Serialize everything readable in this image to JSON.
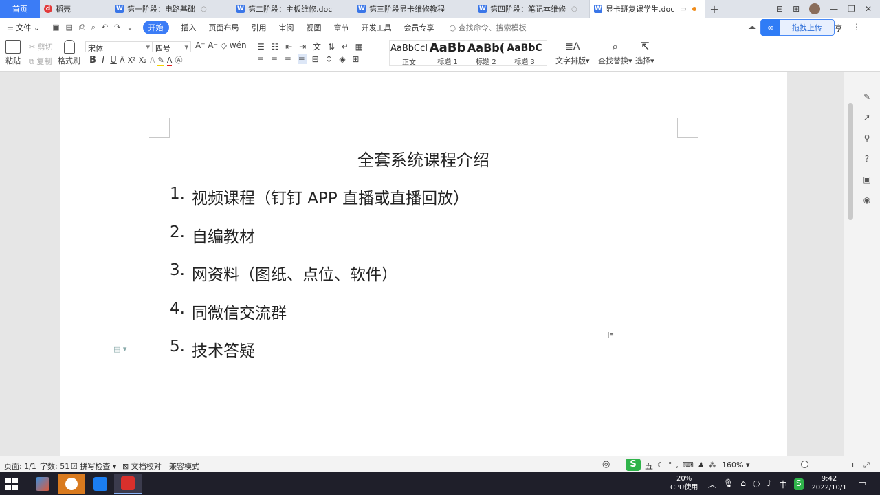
{
  "tabs": {
    "home": "首页",
    "items": [
      {
        "label": "稻壳",
        "icon": "daoke-icon",
        "type": "d"
      },
      {
        "label": "第一阶段：电路基础",
        "icon": "word-doc-icon",
        "type": "w"
      },
      {
        "label": "第二阶段：主板维修.doc",
        "icon": "word-doc-icon",
        "type": "w"
      },
      {
        "label": "第三阶段显卡维修教程",
        "icon": "word-doc-icon",
        "type": "w"
      },
      {
        "label": "第四阶段：笔记本维修",
        "icon": "word-doc-icon",
        "type": "w"
      }
    ],
    "active": "显卡班复课学生.doc"
  },
  "menu": {
    "file": "文件",
    "items": [
      "开始",
      "插入",
      "页面布局",
      "引用",
      "审阅",
      "视图",
      "章节",
      "开发工具",
      "会员专享"
    ],
    "active_index": 0,
    "search_placeholder": "查找命令、搜索模板",
    "upload_label": "拖拽上传",
    "share_label": "享"
  },
  "ribbon": {
    "paste": "粘贴",
    "cut": "剪切",
    "copy": "复制",
    "format_painter": "格式刷",
    "font_name": "宋体",
    "font_size": "四号",
    "bold": "B",
    "italic": "I",
    "underline": "U",
    "styles": [
      {
        "preview": "AaBbCcI",
        "name": "正文"
      },
      {
        "preview": "AaBb",
        "name": "标题 1"
      },
      {
        "preview": "AaBb(",
        "name": "标题 2"
      },
      {
        "preview": "AaBbC",
        "name": "标题 3"
      }
    ],
    "text_layout": "文字排版",
    "find_replace": "查找替换",
    "select": "选择"
  },
  "document": {
    "title": "全套系统课程介绍",
    "items": [
      {
        "num": "1.",
        "text": "视频课程（钉钉 APP  直播或直播回放）"
      },
      {
        "num": "2.",
        "text": "自编教材"
      },
      {
        "num": "3.",
        "text": "网资料（图纸、点位、软件）"
      },
      {
        "num": "4.",
        "text": "同微信交流群"
      },
      {
        "num": "5.",
        "text": "技术答疑"
      }
    ]
  },
  "status": {
    "page": "页面: 1/1",
    "words": "字数: 51",
    "spellcheck": "拼写检查",
    "proof": "文档校对",
    "compat": "兼容模式",
    "ime": "五",
    "zoom": "160%",
    "zoom_level": 0.52
  },
  "taskbar": {
    "cpu_percent": "20%",
    "cpu_label": "CPU使用",
    "ime_lang": "中",
    "time": "9:42",
    "date": "2022/10/1"
  },
  "colors": {
    "accent": "#3b7cf6",
    "ime_green": "#2fb34a"
  }
}
